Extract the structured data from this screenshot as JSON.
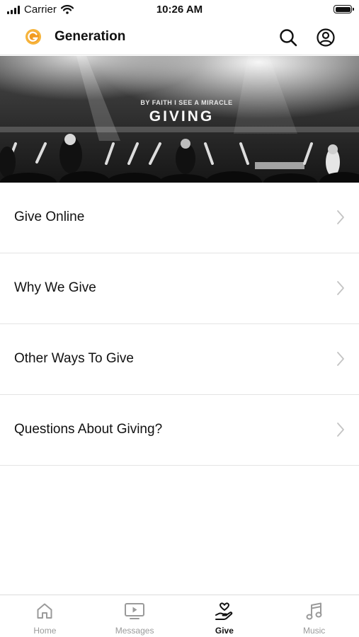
{
  "status_bar": {
    "carrier": "Carrier",
    "time": "10:26 AM"
  },
  "header": {
    "title": "Generation"
  },
  "hero": {
    "subtitle": "BY FAITH I SEE A MIRACLE",
    "title": "GIVING"
  },
  "menu": {
    "items": [
      {
        "label": "Give Online"
      },
      {
        "label": "Why We Give"
      },
      {
        "label": "Other Ways To Give"
      },
      {
        "label": "Questions About Giving?"
      }
    ]
  },
  "tabs": [
    {
      "label": "Home",
      "icon": "home-icon",
      "active": false
    },
    {
      "label": "Messages",
      "icon": "tv-icon",
      "active": false
    },
    {
      "label": "Give",
      "icon": "give-icon",
      "active": true
    },
    {
      "label": "Music",
      "icon": "music-icon",
      "active": false
    }
  ],
  "colors": {
    "brand": "#F29A1F",
    "active_tab": "#111111",
    "inactive_tab": "#9A9A9A"
  }
}
